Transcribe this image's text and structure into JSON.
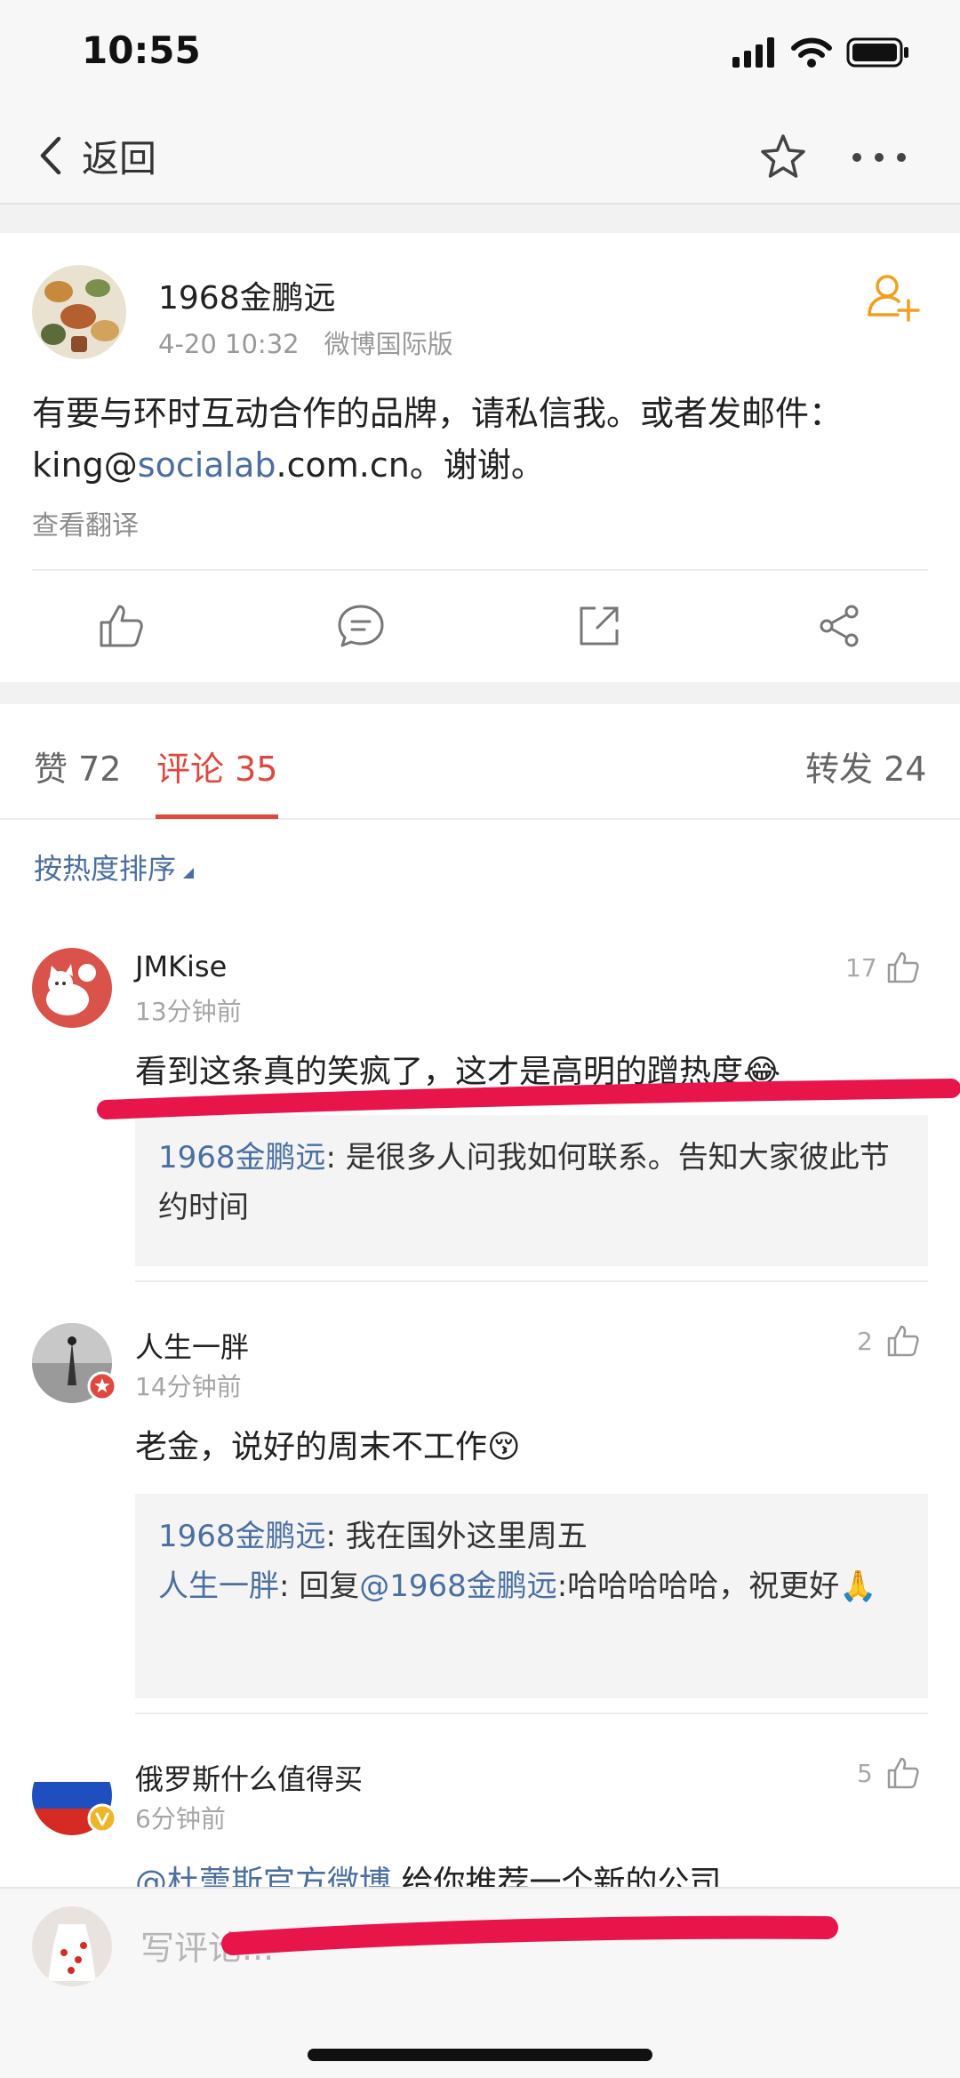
{
  "status_bar": {
    "time": "10:55"
  },
  "nav": {
    "back_label": "返回"
  },
  "post": {
    "author": "1968金鹏远",
    "date": "4-20 10:32",
    "source": "微博国际版",
    "text_part1": "有要与环时互动合作的品牌，请私信我。或者发邮件：king@",
    "text_link": "socialab",
    "text_part2": ".com.cn。谢谢。",
    "translate_label": "查看翻译"
  },
  "tabs": {
    "likes": "赞 72",
    "comments": "评论 35",
    "reposts": "转发 24"
  },
  "sort_label": "按热度排序",
  "comments": [
    {
      "name": "JMKise",
      "time": "13分钟前",
      "likes": "17",
      "text": "看到这条真的笑疯了，这才是高明的蹭热度😂",
      "reply_name": "1968金鹏远",
      "reply_text": ": 是很多人问我如何联系。告知大家彼此节约时间"
    },
    {
      "name": "人生一胖",
      "time": "14分钟前",
      "likes": "2",
      "text": "老金，说好的周末不工作😚",
      "reply1_name": "1968金鹏远",
      "reply1_text": ": 我在国外这里周五",
      "reply2_name": "人生一胖",
      "reply2_mid": ": 回复",
      "reply2_mention": "@1968金鹏远",
      "reply2_text": ":哈哈哈哈哈，祝更好🙏"
    },
    {
      "name": "俄罗斯什么值得买",
      "time": "6分钟前",
      "likes": "5",
      "mention": "@杜蕾斯官方微博",
      "text": " 给你推荐一个新的公司"
    }
  ],
  "input": {
    "placeholder": "写评论..."
  },
  "colors": {
    "accent": "#e0473f",
    "link": "#4a6fa0",
    "follow": "#f0a020"
  }
}
